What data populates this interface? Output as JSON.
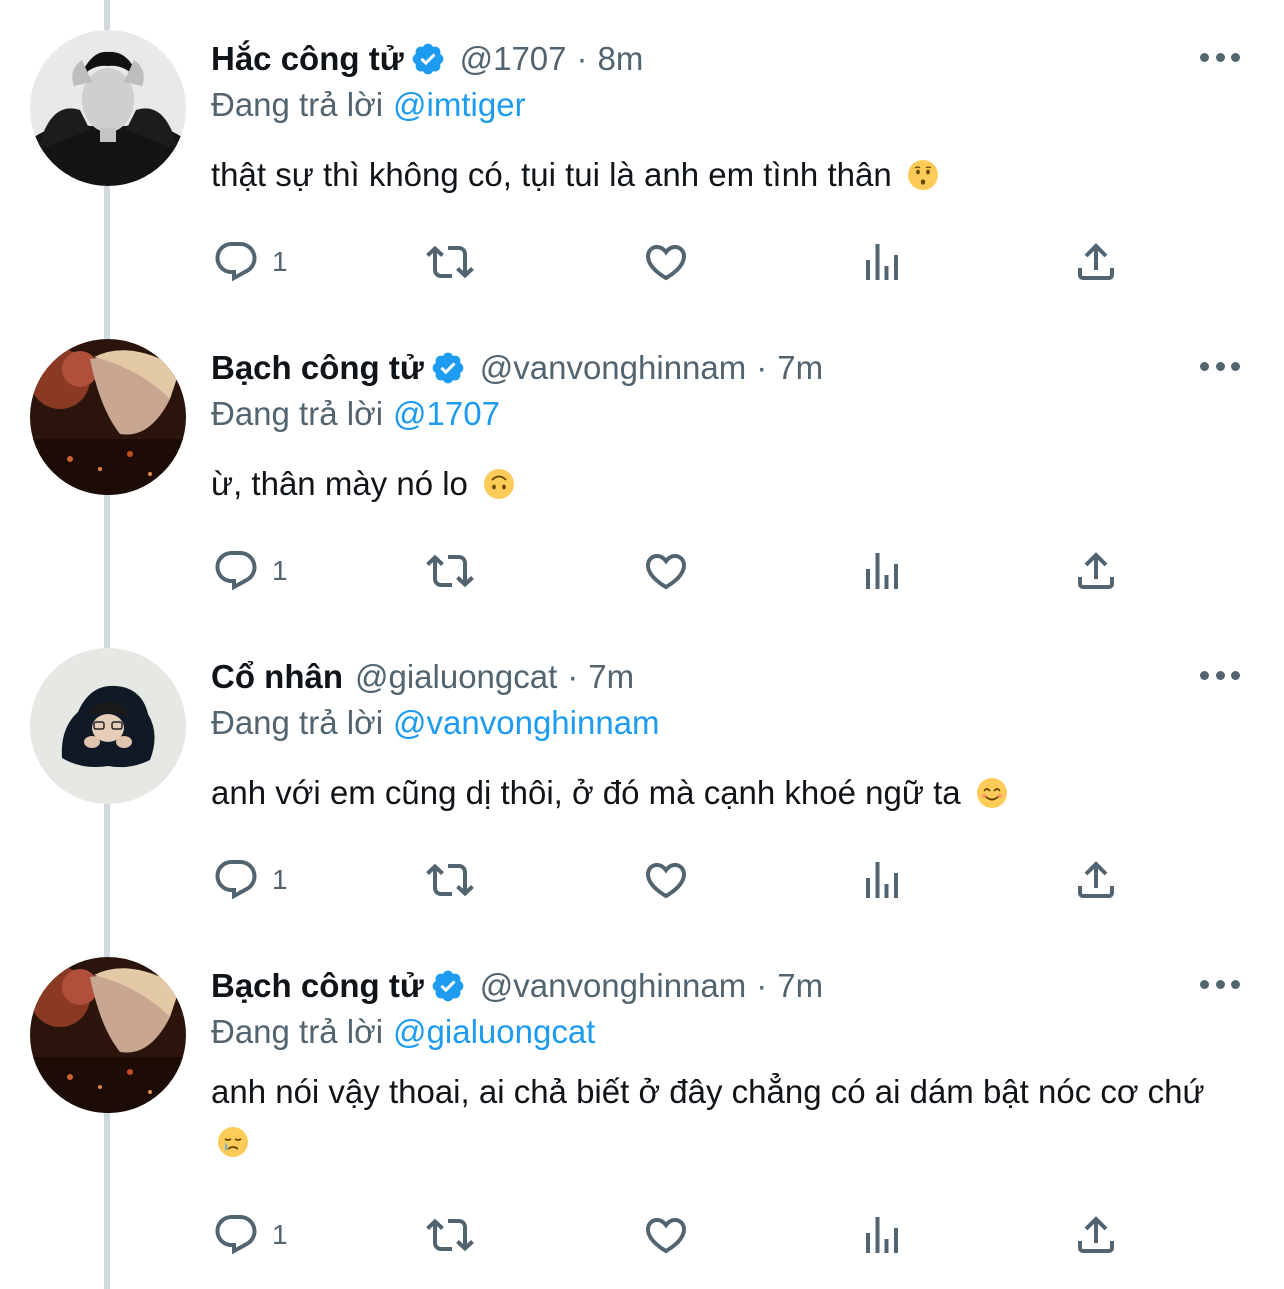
{
  "tweets": [
    {
      "name": "Hắc công tử",
      "verified": true,
      "handle": "@1707",
      "separator": "·",
      "time": "8m",
      "replying_label": "Đang trả lời",
      "replying_to": "@imtiger",
      "text": "thật sự thì không có, tụi tui là anh em tình thân",
      "emoji": "kissing-face",
      "reply_count": "1"
    },
    {
      "name": "Bạch công tử",
      "verified": true,
      "handle": "@vanvonghinnam",
      "separator": "·",
      "time": "7m",
      "replying_label": "Đang trả lời",
      "replying_to": "@1707",
      "text": "ừ, thân mày nó lo",
      "emoji": "upside-down-face",
      "reply_count": "1"
    },
    {
      "name": "Cổ nhân",
      "verified": false,
      "handle": "@gialuongcat",
      "separator": "·",
      "time": "7m",
      "replying_label": "Đang trả lời",
      "replying_to": "@vanvonghinnam",
      "text": "anh với em cũng dị thôi, ở đó mà cạnh khoé ngữ ta",
      "emoji": "smiling-face",
      "reply_count": "1"
    },
    {
      "name": "Bạch công tử",
      "verified": true,
      "handle": "@vanvonghinnam",
      "separator": "·",
      "time": "7m",
      "replying_label": "Đang trả lời",
      "replying_to": "@gialuongcat",
      "text": "anh nói vậy thoai, ai chả biết ở đây chẳng có ai dám bật nóc cơ chứ",
      "emoji": "crying-face",
      "reply_count": "1"
    }
  ],
  "icons": {
    "reply": "reply-bubble-icon",
    "retweet": "retweet-icon",
    "like": "heart-icon",
    "views": "views-bar-chart-icon",
    "share": "share-upload-icon",
    "more": "more-dots-icon",
    "verified": "verified-badge-icon"
  },
  "colors": {
    "accent": "#1d9bf0",
    "text": "#0f1419",
    "secondary": "#536471",
    "thread_line": "#cfd9de"
  }
}
